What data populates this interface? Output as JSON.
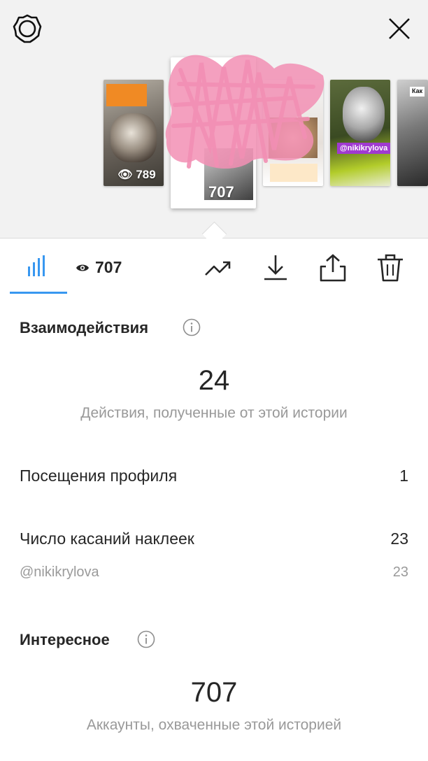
{
  "top": {
    "thumbnails": [
      {
        "views": "789"
      },
      {
        "views": "707"
      },
      {
        "views": ""
      },
      {
        "views": "",
        "tag": "@nikikrylova"
      },
      {
        "views": "",
        "tag": "Как"
      }
    ]
  },
  "tabbar": {
    "views_count": "707"
  },
  "interactions": {
    "title": "Взаимодействия",
    "total": "24",
    "caption": "Действия, полученные от этой истории",
    "rows": [
      {
        "label": "Посещения профиля",
        "value": "1"
      },
      {
        "label": "Число касаний наклеек",
        "value": "23"
      }
    ],
    "sub_rows": [
      {
        "label": "@nikikrylova",
        "value": "23"
      }
    ]
  },
  "discovery": {
    "title": "Интересное",
    "total": "707",
    "caption": "Аккаунты, охваченные этой историей"
  },
  "colors": {
    "accent": "#3897f0",
    "redaction": "#f28fb4"
  },
  "icons": [
    "settings-icon",
    "close-icon",
    "bar-chart-icon",
    "eye-icon",
    "trending-icon",
    "download-icon",
    "share-icon",
    "trash-icon",
    "info-icon"
  ]
}
